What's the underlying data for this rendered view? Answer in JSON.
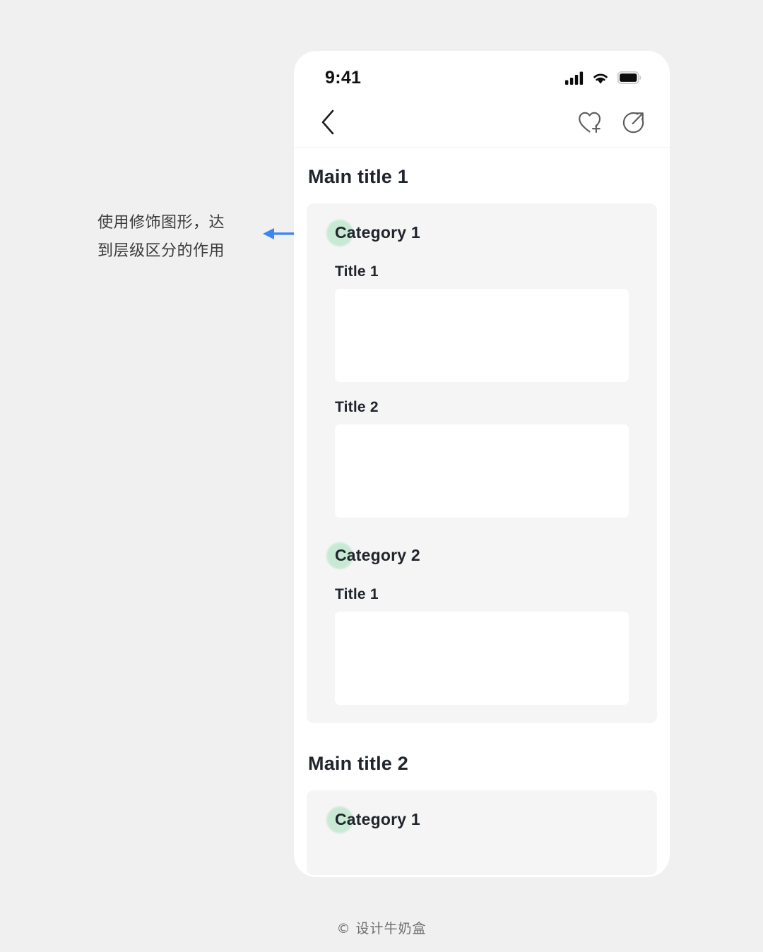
{
  "annotation": {
    "line1": "使用修饰图形，达",
    "line2": "到层级区分的作用",
    "arrow_color": "#3d86f0",
    "arrow_direction": "left"
  },
  "phone": {
    "status_bar": {
      "time": "9:41",
      "icons": [
        "cellular-signal-icon",
        "wifi-icon",
        "battery-icon"
      ]
    },
    "nav_bar": {
      "back_icon": "chevron-left-icon",
      "actions": [
        {
          "icon": "heart-plus-icon"
        },
        {
          "icon": "share-circle-icon"
        }
      ]
    },
    "sections": [
      {
        "main_title": "Main title 1",
        "categories": [
          {
            "label": "Category 1",
            "items": [
              {
                "title": "Title 1"
              },
              {
                "title": "Title 2"
              }
            ]
          },
          {
            "label": "Category 2",
            "items": [
              {
                "title": "Title 1"
              }
            ]
          }
        ]
      },
      {
        "main_title": "Main title 2",
        "categories": [
          {
            "label": "Category 1",
            "items": []
          }
        ]
      }
    ]
  },
  "footer": {
    "credit": "© 设计牛奶盒"
  },
  "colors": {
    "page_background": "#f0f0f0",
    "phone_background": "#ffffff",
    "section_background": "#f5f5f6",
    "card_background": "#ffffff",
    "text_primary": "#20242b",
    "accent_blob": "#c6ead4",
    "arrow_blue": "#3d86f0"
  }
}
